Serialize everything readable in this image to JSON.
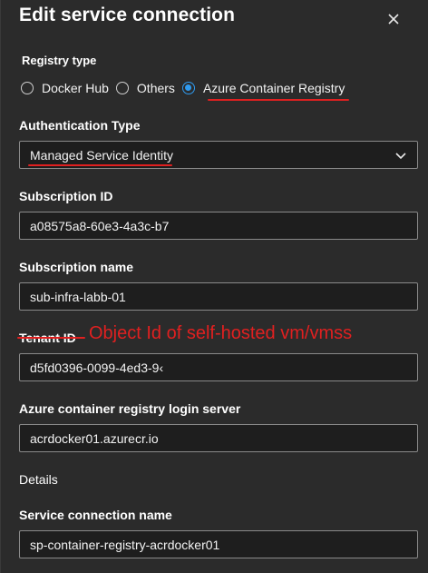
{
  "dialog": {
    "title": "Edit service connection",
    "close_icon": "close-icon"
  },
  "registry_type": {
    "label": "Registry type",
    "options": [
      {
        "label": "Docker Hub",
        "checked": false
      },
      {
        "label": "Others",
        "checked": false
      },
      {
        "label": "Azure Container Registry",
        "checked": true
      }
    ]
  },
  "authentication_type": {
    "label": "Authentication Type",
    "value": "Managed Service Identity",
    "icon": "chevron-down-icon"
  },
  "subscription_id": {
    "label": "Subscription ID",
    "value": "a08575a8-60e3-4a3c-b7"
  },
  "subscription_name": {
    "label": "Subscription name",
    "value": "sub-infra-labb-01"
  },
  "tenant_id": {
    "label": "Tenant ID",
    "value": "d5fd0396-0099-4ed3-9‹"
  },
  "annotation": {
    "text": "Object Id of self-hosted vm/vmss",
    "color": "#e02020"
  },
  "login_server": {
    "label": "Azure container registry login server",
    "value": "acrdocker01.azurecr.io"
  },
  "details": {
    "label": "Details"
  },
  "service_connection_name": {
    "label": "Service connection name",
    "value": "sp-container-registry-acrdocker01"
  },
  "colors": {
    "background": "#2b2b2b",
    "accent": "#2f9bf0",
    "annotation": "#e02020"
  }
}
